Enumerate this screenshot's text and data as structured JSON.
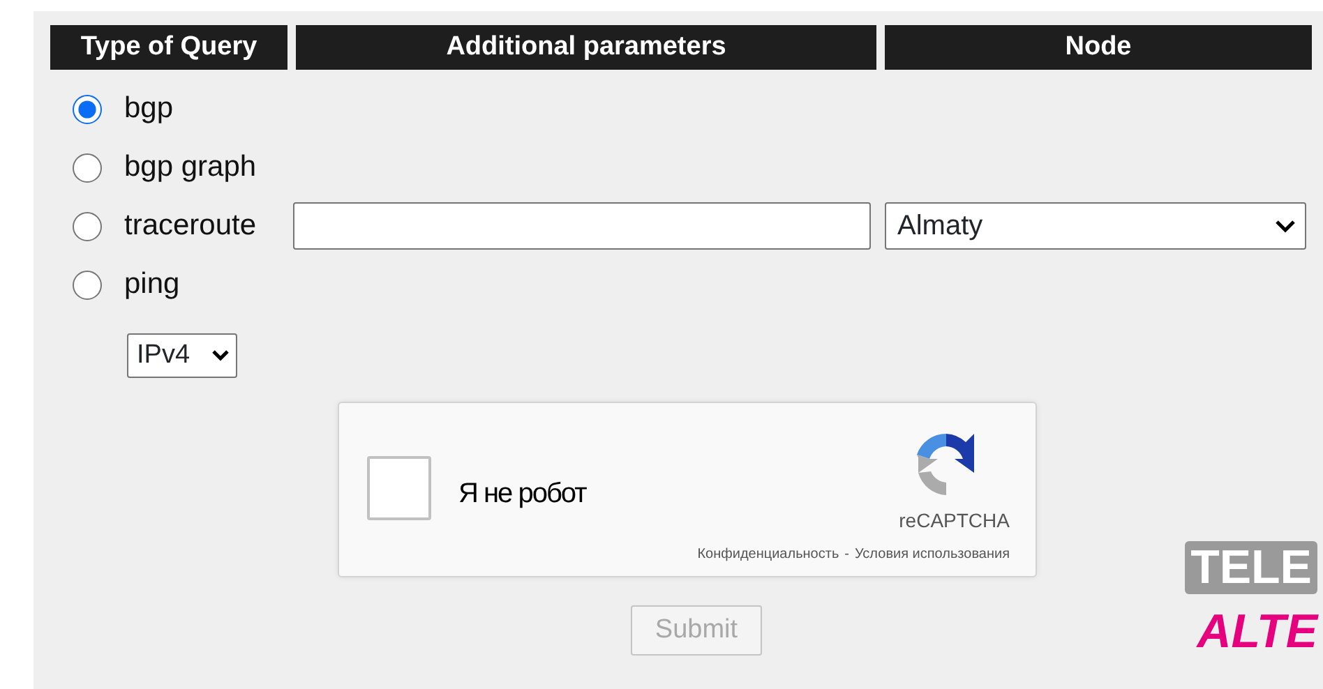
{
  "header": {
    "columns": [
      "Type of Query",
      "Additional parameters",
      "Node"
    ]
  },
  "query_types": [
    {
      "label": "bgp",
      "selected": true
    },
    {
      "label": "bgp graph",
      "selected": false
    },
    {
      "label": "traceroute",
      "selected": false
    },
    {
      "label": "ping",
      "selected": false
    }
  ],
  "node": {
    "value": "Almaty"
  },
  "ip_version": {
    "value": "IPv4"
  },
  "captcha": {
    "checked": false,
    "label": "Я не робот",
    "brand": "reCAPTCHA",
    "privacy_link": "Конфиденциальность",
    "separator": "-",
    "terms_link": "Условия использования"
  },
  "submit": {
    "label": "Submit",
    "disabled": true
  },
  "logos": [
    {
      "text": "TELE",
      "kind": "block"
    },
    {
      "text": "ALTE",
      "kind": "slanted"
    }
  ]
}
